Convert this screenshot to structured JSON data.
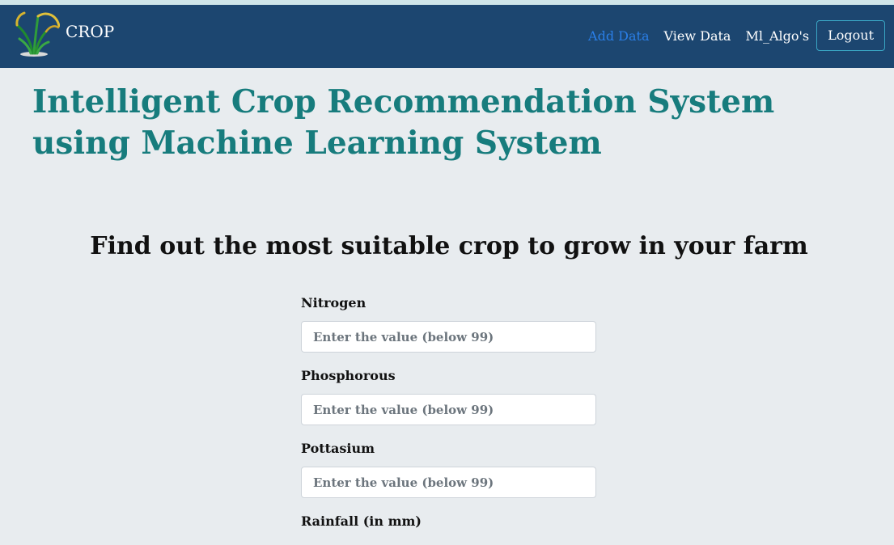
{
  "navbar": {
    "brand": "CROP",
    "links": [
      "Add Data",
      "View Data",
      "Ml_Algo's"
    ],
    "logout_label": "Logout"
  },
  "hero": {
    "title": "Intelligent Crop Recommendation System using Machine Learning System"
  },
  "form": {
    "heading": "Find out the most suitable crop to grow in your farm",
    "fields": [
      {
        "label": "Nitrogen",
        "placeholder": "Enter the value (below 99)",
        "value": ""
      },
      {
        "label": "Phosphorous",
        "placeholder": "Enter the value (below 99)",
        "value": ""
      },
      {
        "label": "Pottasium",
        "placeholder": "Enter the value (below 99)",
        "value": ""
      },
      {
        "label": "Rainfall (in mm)"
      }
    ]
  },
  "colors": {
    "navbar_bg": "#1c4670",
    "page_bg": "#e8ecef",
    "title_teal": "#177c7d",
    "active_link": "#2a7fe8",
    "logout_border": "#39a6c4"
  },
  "icons": {
    "logo": "crop-plant-icon"
  }
}
